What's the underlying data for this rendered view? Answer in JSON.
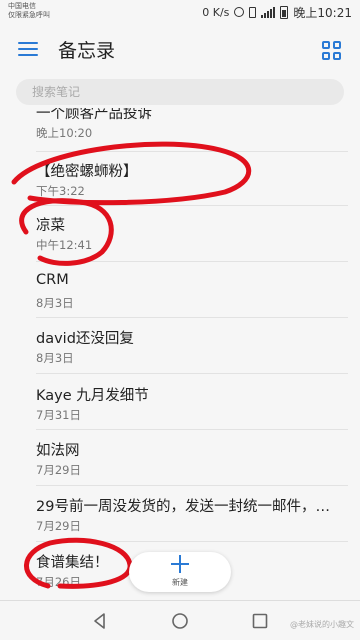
{
  "status_bar": {
    "carrier_line1": "中国电信",
    "carrier_line2": "仅限紧急呼叫",
    "speed": "0 K/s",
    "time": "晚上10:21"
  },
  "app_bar": {
    "title": "备忘录"
  },
  "search": {
    "placeholder": "搜索笔记"
  },
  "notes": [
    {
      "title": "一个顾客产品投诉",
      "date": "晚上10:20"
    },
    {
      "title": "【绝密螺蛳粉】",
      "date": "下午3:22"
    },
    {
      "title": "凉菜",
      "date": "中午12:41"
    },
    {
      "title": "CRM",
      "date": "8月3日"
    },
    {
      "title": "david还没回复",
      "date": "8月3日"
    },
    {
      "title": "Kaye 九月发细节",
      "date": "7月31日"
    },
    {
      "title": "如法网",
      "date": "7月29日"
    },
    {
      "title": "29号前一周没发货的，发送一封统一邮件，…",
      "date": "7月29日"
    },
    {
      "title": "食谱集结！",
      "date": "7月26日"
    }
  ],
  "fab": {
    "label": "新建"
  },
  "watermark": "@老妹说的小趣文",
  "colors": {
    "accent": "#2a7ad5",
    "annotation": "#e0101c"
  }
}
